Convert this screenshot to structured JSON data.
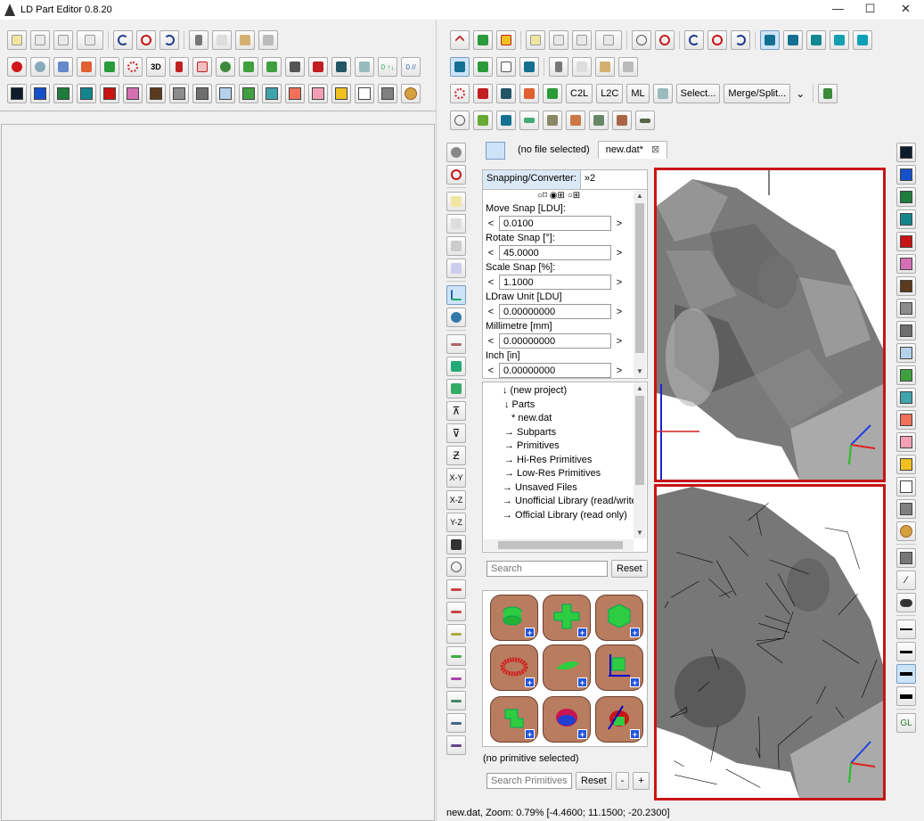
{
  "window": {
    "title": "LD Part Editor 0.8.20",
    "controls": {
      "minimize": "—",
      "maximize": "☐",
      "close": "✕"
    }
  },
  "left_toolbar": {
    "row2_labels": {
      "view3d": "3D",
      "grid1": "0 ↑↓",
      "grid2": "0 //"
    },
    "colors": [
      "#0d1b2a",
      "#1450c8",
      "#1e7d3c",
      "#12868c",
      "#c81414",
      "#d46fb4",
      "#5c3a1e",
      "#8c8c8c",
      "#6e6e6e",
      "#b4d2ec",
      "#40a040",
      "#40a4ac",
      "#f0705a",
      "#f4a0b4",
      "#f0c020",
      "#ffffff",
      "#808080"
    ]
  },
  "right_toolbar": {
    "row3_labels": {
      "c2l": "C2L",
      "l2c": "L2C",
      "ml": "ML",
      "select": "Select...",
      "merge_split": "Merge/Split...",
      "more": "⌄"
    }
  },
  "side_toolbar": {
    "labels": {
      "xy": "X-Y",
      "xz": "X-Z",
      "yz": "Y-Z"
    }
  },
  "color_sidebar": {
    "colors": [
      "#0d1b2a",
      "#1450c8",
      "#1e7d3c",
      "#12868c",
      "#c81414",
      "#d46fb4",
      "#5c3a1e",
      "#8c8c8c",
      "#6e6e6e",
      "#b4d2ec",
      "#40a040",
      "#40a4ac",
      "#f0705a",
      "#f4a0b4",
      "#f0c020",
      "#ffffff",
      "#808080"
    ],
    "gl_label": "GL"
  },
  "tabs": [
    {
      "label": "(no file selected)"
    },
    {
      "label": "new.dat*",
      "close": "⊠"
    }
  ],
  "snapping": {
    "tab_label": "Snapping/Converter:",
    "tab_more": "»2",
    "radio_row": "○⌑ ◉⊞ ○⊞",
    "fields": [
      {
        "label": "Move Snap [LDU]:",
        "value": "0.0100"
      },
      {
        "label": "Rotate Snap [°]:",
        "value": "45.0000"
      },
      {
        "label": "Scale Snap [%]:",
        "value": "1.1000"
      },
      {
        "label": "LDraw Unit [LDU]",
        "value": "0.00000000"
      },
      {
        "label": "Millimetre [mm]",
        "value": "0.00000000"
      },
      {
        "label": "Inch [in]",
        "value": "0.00000000"
      }
    ],
    "arrow_left": "<",
    "arrow_right": ">"
  },
  "project_tree": {
    "items": [
      {
        "text": "↓ (new project)",
        "indent": 22
      },
      {
        "text": "↓ Parts",
        "indent": 24
      },
      {
        "text": "* new.dat",
        "indent": 32
      },
      {
        "text": "→ Subparts",
        "indent": 24
      },
      {
        "text": "→ Primitives",
        "indent": 24
      },
      {
        "text": "→ Hi-Res Primitives",
        "indent": 24
      },
      {
        "text": "→ Low-Res Primitives",
        "indent": 24
      },
      {
        "text": "→ Unsaved Files",
        "indent": 22
      },
      {
        "text": "→ Unofficial Library (read/write)",
        "indent": 22
      },
      {
        "text": "→ Official Library (read only)",
        "indent": 22
      }
    ]
  },
  "search": {
    "placeholder": "Search",
    "reset": "Reset"
  },
  "primitives": {
    "status": "(no primitive selected)",
    "search_placeholder": "Search Primitives",
    "reset": "Reset",
    "zoom_out": "-",
    "zoom_in": "+",
    "plus": "+"
  },
  "statusbar": {
    "text": "new.dat, Zoom: 0.79% [-4.4600; 11.1500; -20.2300]"
  }
}
